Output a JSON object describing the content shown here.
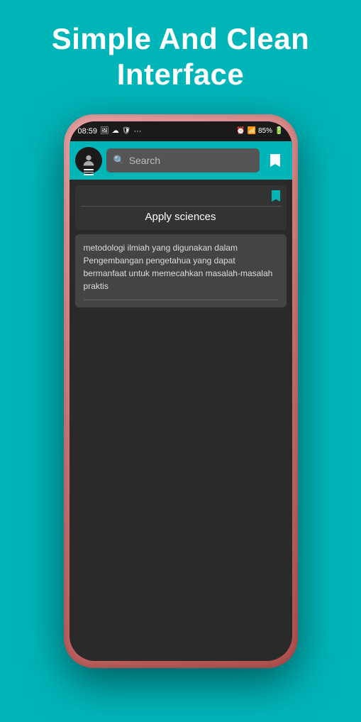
{
  "header": {
    "line1": "Simple And Clean",
    "line2": "Interface"
  },
  "status_bar": {
    "time": "08:59",
    "battery_percent": "85%",
    "icons": [
      "image",
      "cloud",
      "shield",
      "dots",
      "alarm",
      "signal",
      "wifi",
      "battery"
    ]
  },
  "top_bar": {
    "search_placeholder": "Search",
    "menu_label": "Menu",
    "bookmark_label": "Bookmark"
  },
  "content": {
    "bookmark_icon": "🔖",
    "category_title": "Apply sciences",
    "description": "metodologi ilmiah yang digunakan dalam Pengembangan pengetahua yang dapat bermanfaat untuk memecahkan masalah-masalah praktis"
  }
}
